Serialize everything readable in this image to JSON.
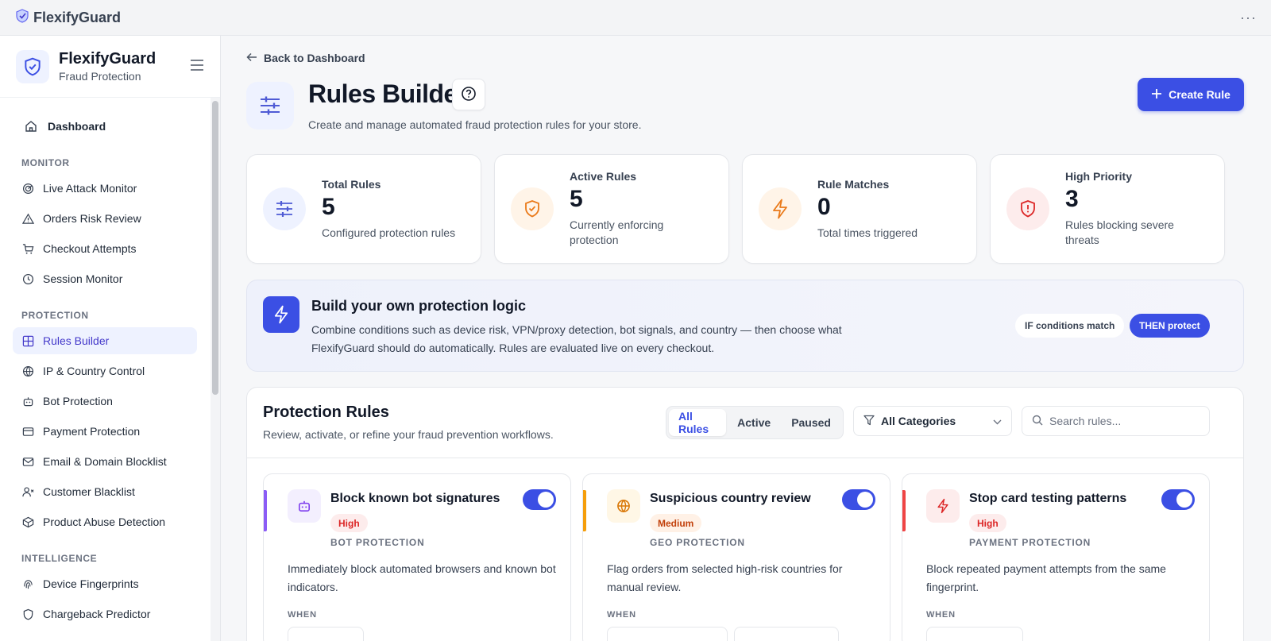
{
  "app": {
    "title": "FlexifyGuard",
    "menu_icon": "more-horizontal-icon"
  },
  "sidebar": {
    "brand": "FlexifyGuard",
    "tagline": "Fraud Protection",
    "dashboard": "Dashboard",
    "sections": [
      {
        "title": "MONITOR",
        "items": [
          {
            "label": "Live Attack Monitor",
            "icon": "radar-icon"
          },
          {
            "label": "Orders Risk Review",
            "icon": "warning-triangle-icon"
          },
          {
            "label": "Checkout Attempts",
            "icon": "cart-icon"
          },
          {
            "label": "Session Monitor",
            "icon": "clock-icon"
          }
        ]
      },
      {
        "title": "PROTECTION",
        "items": [
          {
            "label": "Rules Builder",
            "icon": "grid-icon",
            "active": true
          },
          {
            "label": "IP & Country Control",
            "icon": "globe-icon"
          },
          {
            "label": "Bot Protection",
            "icon": "bot-icon"
          },
          {
            "label": "Payment Protection",
            "icon": "credit-card-icon"
          },
          {
            "label": "Email & Domain Blocklist",
            "icon": "mail-icon"
          },
          {
            "label": "Customer Blacklist",
            "icon": "user-x-icon"
          },
          {
            "label": "Product Abuse Detection",
            "icon": "package-icon"
          }
        ]
      },
      {
        "title": "INTELLIGENCE",
        "items": [
          {
            "label": "Device Fingerprints",
            "icon": "fingerprint-icon"
          },
          {
            "label": "Chargeback Predictor",
            "icon": "shield-icon"
          }
        ]
      }
    ]
  },
  "header": {
    "back": "Back to Dashboard",
    "title": "Rules Builder",
    "subtitle": "Create and manage automated fraud protection rules for your store.",
    "create_button": "Create Rule"
  },
  "stats": [
    {
      "label": "Total Rules",
      "value": "5",
      "desc": "Configured protection rules",
      "color": "#4f5bd5",
      "bg": "#eef2ff",
      "icon": "sliders-icon"
    },
    {
      "label": "Active Rules",
      "value": "5",
      "desc": "Currently enforcing protection",
      "color": "#ea7a1a",
      "bg": "#fff4e8",
      "icon": "shield-check-icon"
    },
    {
      "label": "Rule Matches",
      "value": "0",
      "desc": "Total times triggered",
      "color": "#ea7a1a",
      "bg": "#fff4e8",
      "icon": "zap-icon"
    },
    {
      "label": "High Priority",
      "value": "3",
      "desc": "Rules blocking severe threats",
      "color": "#dc2626",
      "bg": "#fdecec",
      "icon": "shield-alert-icon"
    }
  ],
  "banner": {
    "title": "Build your own protection logic",
    "text": "Combine conditions such as device risk, VPN/proxy detection, bot signals, and country — then choose what FlexifyGuard should do automatically. Rules are evaluated live on every checkout.",
    "pill_if": "IF conditions match",
    "pill_then": "THEN protect"
  },
  "rules": {
    "title": "Protection Rules",
    "subtitle": "Review, activate, or refine your fraud prevention workflows.",
    "tabs": [
      "All Rules",
      "Active",
      "Paused"
    ],
    "category_select": "All Categories",
    "search_placeholder": "Search rules...",
    "when_label": "WHEN",
    "cards": [
      {
        "name": "Block known bot signatures",
        "priority": "High",
        "category": "BOT PROTECTION",
        "desc": "Immediately block automated browsers and known bot indicators.",
        "accent": "#8b5cf6",
        "icon_color": "#7c3aed",
        "icon_bg": "#f3effe",
        "badge_color": "#dc2626",
        "badge_bg": "#fdecec",
        "icon": "bot-icon"
      },
      {
        "name": "Suspicious country review",
        "priority": "Medium",
        "category": "GEO PROTECTION",
        "desc": "Flag orders from selected high-risk countries for manual review.",
        "accent": "#f59e0b",
        "icon_color": "#d97706",
        "icon_bg": "#fff7e6",
        "badge_color": "#c2410c",
        "badge_bg": "#fff1e6",
        "icon": "globe-icon"
      },
      {
        "name": "Stop card testing patterns",
        "priority": "High",
        "category": "PAYMENT PROTECTION",
        "desc": "Block repeated payment attempts from the same fingerprint.",
        "accent": "#ef4444",
        "icon_color": "#dc2626",
        "icon_bg": "#fdecec",
        "badge_color": "#dc2626",
        "badge_bg": "#fdecec",
        "icon": "zap-icon"
      }
    ]
  }
}
